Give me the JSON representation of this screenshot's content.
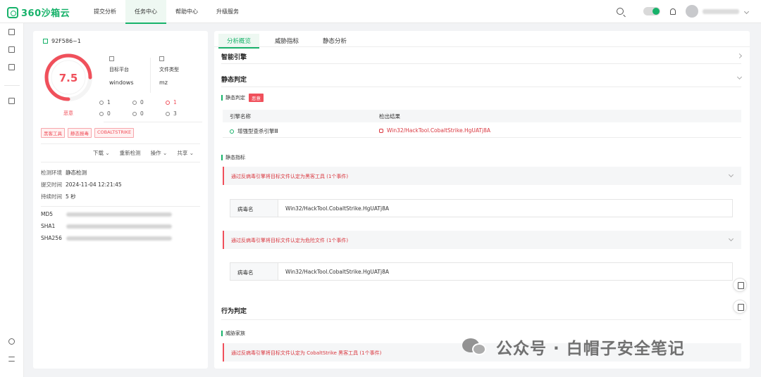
{
  "header": {
    "logo_text": "360沙箱云",
    "nav": [
      "提交分析",
      "任务中心",
      "帮助中心",
      "升级服务"
    ]
  },
  "task": {
    "id": "92F586~1",
    "score": "7.5",
    "verdict": "恶意",
    "platform_label": "目标平台",
    "platform_value": "windows",
    "filetype_label": "文件类型",
    "filetype_value": "mz",
    "stats": [
      "1",
      "0",
      "1",
      "0",
      "0",
      "3"
    ],
    "tags": [
      "黑客工具",
      "静态报毒",
      "COBALTSTRIKE"
    ],
    "actions": [
      "下载 ⌄",
      "重新检测",
      "操作 ⌄",
      "共享 ⌄"
    ],
    "env_label": "检测环境",
    "env_value": "静态检测",
    "submit_label": "提交时间",
    "submit_value": "2024-11-04 12:21:45",
    "duration_label": "持续时间",
    "duration_value": "5 秒",
    "hash_labels": [
      "MD5",
      "SHA1",
      "SHA256"
    ]
  },
  "tabs": [
    "分析概览",
    "威胁指标",
    "静态分析"
  ],
  "overview": {
    "engine_title": "智能引擎",
    "static_title": "静态判定",
    "static_sub": "静态判定",
    "static_badge": "恶意",
    "col_engine": "引擎名称",
    "col_result": "检出结果",
    "engine_name": "增强型查杀引擎Ⅲ",
    "engine_result": "Win32/HackTool.CobaltStrike.HgUATj8A",
    "indicator_sub": "静态指标",
    "event1": "通过反病毒引擎将目标文件认定为黑客工具 (1个事件)",
    "virus_key1": "病毒名",
    "virus_val1": "Win32/HackTool.CobaltStrike.HgUATj8A",
    "event2": "通过反病毒引擎将目标文件认定为危险文件 (1个事件)",
    "virus_key2": "病毒名",
    "virus_val2": "Win32/HackTool.CobaltStrike.HgUATj8A",
    "behavior_title": "行为判定",
    "family_sub": "威胁家族",
    "event3": "通过反病毒引擎将目标文件认定为 CobaltStrike 黑客工具 (1个事件)"
  },
  "watermark": "公众号 · 白帽子安全笔记",
  "colors": {
    "accent": "#17b26a",
    "danger": "#f0505b"
  }
}
